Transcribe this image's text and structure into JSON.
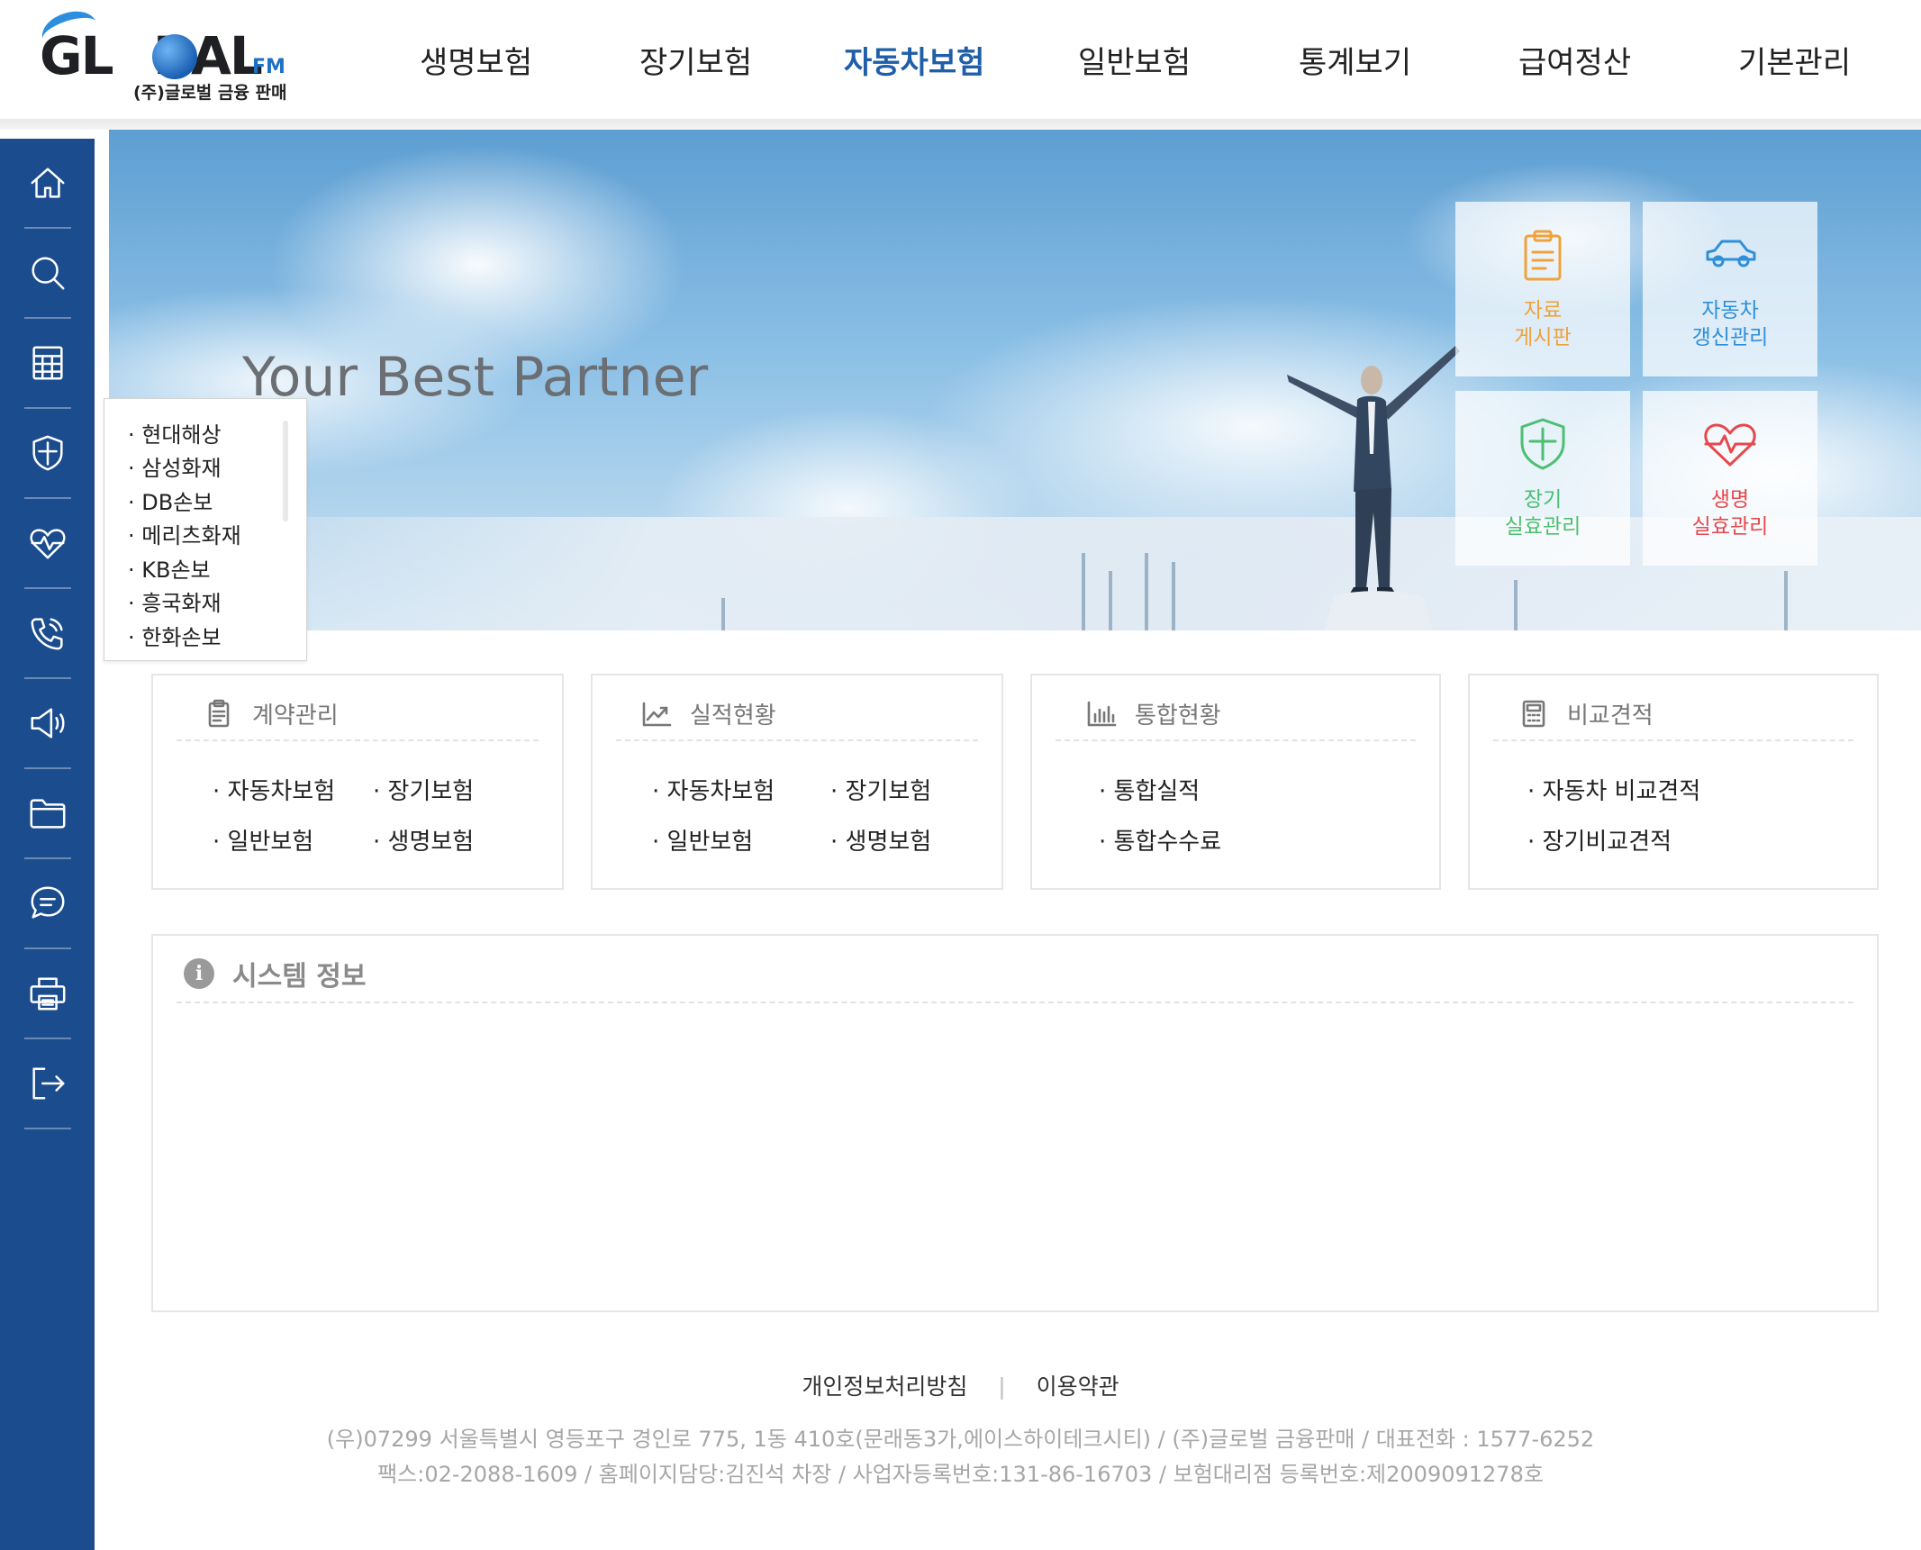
{
  "logo": {
    "text_main": "GL",
    "text_o": "O",
    "text_rest": "BAL",
    "text_fm": "FM",
    "subtitle": "(주)글로벌 금융 판매"
  },
  "topnav": {
    "items": [
      {
        "label": "생명보험",
        "active": false
      },
      {
        "label": "장기보험",
        "active": false
      },
      {
        "label": "자동차보험",
        "active": true
      },
      {
        "label": "일반보험",
        "active": false
      },
      {
        "label": "통계보기",
        "active": false
      },
      {
        "label": "급여정산",
        "active": false
      },
      {
        "label": "기본관리",
        "active": false
      }
    ]
  },
  "sidebar": {
    "icons": [
      "home-icon",
      "search-icon",
      "calculator-icon",
      "shield-icon",
      "heartbeat-icon",
      "phone-call-icon",
      "megaphone-icon",
      "folder-icon",
      "chat-icon",
      "printer-icon",
      "logout-icon"
    ]
  },
  "hero": {
    "tagline": "Your Best Partner",
    "quick_links": [
      {
        "label": "자료\n게시판",
        "icon": "clipboard-icon",
        "color": "#f0a23a"
      },
      {
        "label": "자동차\n갱신관리",
        "icon": "car-icon",
        "color": "#2f8fd8"
      },
      {
        "label": "장기\n실효관리",
        "icon": "shield-check-icon",
        "color": "#4bbf72"
      },
      {
        "label": "생명\n실효관리",
        "icon": "heartbeat-icon",
        "color": "#e5484d"
      }
    ]
  },
  "dropdown": {
    "items": [
      "· 현대해상",
      "· 삼성화재",
      "· DB손보",
      "· 메리츠화재",
      "· KB손보",
      "· 흥국화재",
      "· 한화손보"
    ]
  },
  "cards": [
    {
      "title": "계약관리",
      "icon": "clipboard-icon",
      "links": [
        "· 자동차보험",
        "· 장기보험",
        "· 일반보험",
        "· 생명보험"
      ]
    },
    {
      "title": "실적현황",
      "icon": "trend-chart-icon",
      "links": [
        "· 자동차보험",
        "· 장기보험",
        "· 일반보험",
        "· 생명보험"
      ]
    },
    {
      "title": "통합현황",
      "icon": "bar-chart-icon",
      "links": [
        "· 통합실적",
        "· 통합수수료"
      ]
    },
    {
      "title": "비교견적",
      "icon": "calculator-icon",
      "links": [
        "· 자동차 비교견적",
        "· 장기비교견적"
      ]
    }
  ],
  "system_info": {
    "title": "시스템 정보",
    "icon_glyph": "i"
  },
  "footer": {
    "privacy": "개인정보처리방침",
    "separator": "|",
    "terms": "이용약관",
    "address_line1": "(우)07299 서울특별시 영등포구 경인로 775, 1동 410호(문래동3가,에이스하이테크시티) / (주)글로벌 금융판매 / 대표전화 : 1577-6252",
    "address_line2": "팩스:02-2088-1609 / 홈페이지담당:김진석 차장 / 사업자등록번호:131-86-16703 / 보험대리점 등록번호:제2009091278호"
  },
  "colors": {
    "brand_blue": "#1b4c8e",
    "active_nav": "#1f5fa8"
  }
}
